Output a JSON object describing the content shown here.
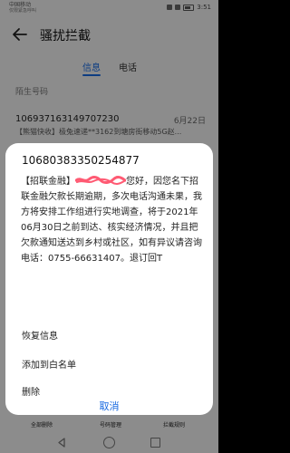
{
  "status": {
    "carrier": "中国移动",
    "carrier_sub": "仅限紧急呼叫",
    "time": "3:51"
  },
  "header": {
    "title": "骚扰拦截"
  },
  "tabs": [
    {
      "label": "信息"
    },
    {
      "label": "电话"
    }
  ],
  "section_label": "陌生号码",
  "message": {
    "number": "106937163149707230",
    "date": "6月22日",
    "preview": "【熊猫快收】极兔速递**3162到塘房街移动5G赵..."
  },
  "dialog": {
    "number": "10680383350254877",
    "body_before": "【招联金融】",
    "body_after": "您好，因您名下招联金融欠款长期逾期，多次电话沟通未果，我方将安排工作组进行实地调查，将于2021年06月30日之前到达、核实经济情况，并且把欠款通知送达到乡村或社区，如有异议请咨询电话：0755-66631407。退订回T",
    "options": [
      "恢复信息",
      "添加到白名单",
      "删除"
    ],
    "cancel": "取消"
  },
  "bottom_bar": [
    "全部删除",
    "号码管理",
    "拦截规则"
  ],
  "colors": {
    "accent": "#1769e0",
    "redaction": "#ff5a73"
  }
}
